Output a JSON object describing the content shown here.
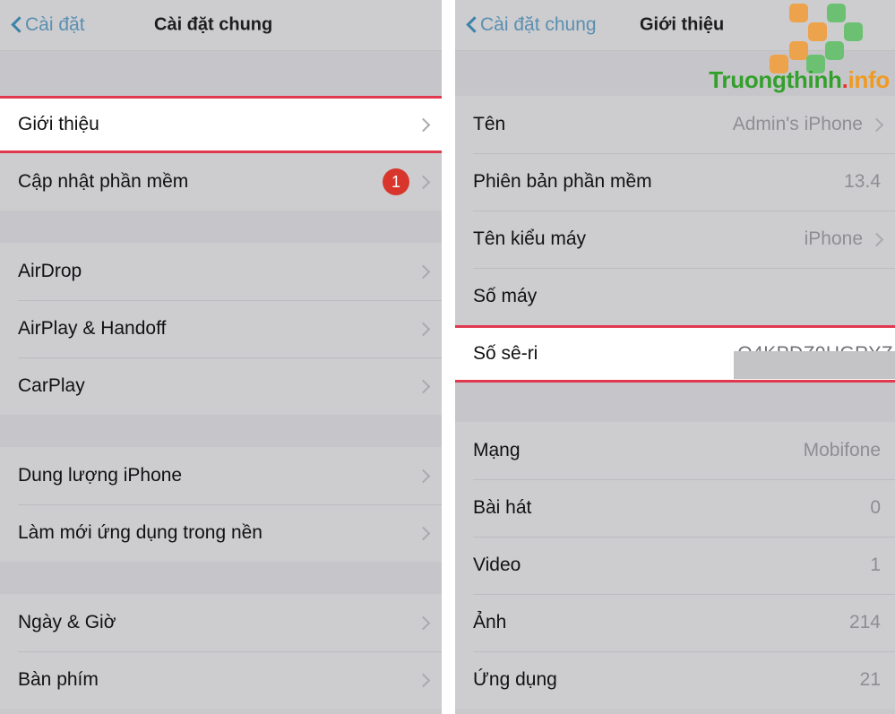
{
  "left_panel": {
    "nav": {
      "back_label": "Cài đặt",
      "back_icon": "chevron-left-icon",
      "title": "Cài đặt chung"
    },
    "groups": [
      {
        "rows": [
          {
            "label": "Giới thiệu",
            "value": "",
            "chevron": true,
            "badge": null,
            "highlighted": true
          },
          {
            "label": "Cập nhật phần mềm",
            "value": "",
            "chevron": true,
            "badge": "1",
            "highlighted": false
          }
        ]
      },
      {
        "rows": [
          {
            "label": "AirDrop",
            "value": "",
            "chevron": true,
            "badge": null,
            "highlighted": false
          },
          {
            "label": "AirPlay & Handoff",
            "value": "",
            "chevron": true,
            "badge": null,
            "highlighted": false
          },
          {
            "label": "CarPlay",
            "value": "",
            "chevron": true,
            "badge": null,
            "highlighted": false
          }
        ]
      },
      {
        "rows": [
          {
            "label": "Dung lượng iPhone",
            "value": "",
            "chevron": true,
            "badge": null,
            "highlighted": false
          },
          {
            "label": "Làm mới ứng dụng trong nền",
            "value": "",
            "chevron": true,
            "badge": null,
            "highlighted": false
          }
        ]
      },
      {
        "rows": [
          {
            "label": "Ngày & Giờ",
            "value": "",
            "chevron": true,
            "badge": null,
            "highlighted": false
          },
          {
            "label": "Bàn phím",
            "value": "",
            "chevron": true,
            "badge": null,
            "highlighted": false
          }
        ]
      }
    ]
  },
  "right_panel": {
    "nav": {
      "back_label": "Cài đặt chung",
      "back_icon": "chevron-left-icon",
      "title": "Giới thiệu"
    },
    "groups": [
      {
        "rows": [
          {
            "label": "Tên",
            "value": "Admin's iPhone",
            "chevron": true,
            "badge": null,
            "highlighted": false
          },
          {
            "label": "Phiên bản phần mềm",
            "value": "13.4",
            "chevron": false,
            "badge": null,
            "highlighted": false
          },
          {
            "label": "Tên kiểu máy",
            "value": "iPhone",
            "chevron": true,
            "badge": null,
            "highlighted": false
          },
          {
            "label": "Số máy",
            "value": "",
            "chevron": false,
            "badge": null,
            "highlighted": false
          },
          {
            "label": "Số sê-ri",
            "value": "Q4KPDZ0HGRYZ",
            "chevron": false,
            "badge": null,
            "highlighted": true,
            "censored": true
          }
        ]
      },
      {
        "rows": [
          {
            "label": "Mạng",
            "value": "Mobifone",
            "chevron": false,
            "badge": null,
            "highlighted": false
          },
          {
            "label": "Bài hát",
            "value": "0",
            "chevron": false,
            "badge": null,
            "highlighted": false
          },
          {
            "label": "Video",
            "value": "1",
            "chevron": false,
            "badge": null,
            "highlighted": false
          },
          {
            "label": "Ảnh",
            "value": "214",
            "chevron": false,
            "badge": null,
            "highlighted": false
          },
          {
            "label": "Ứng dụng",
            "value": "21",
            "chevron": false,
            "badge": null,
            "highlighted": false
          }
        ]
      }
    ]
  },
  "watermark": {
    "brand_part1": "Truongthinh",
    "brand_dot": ".",
    "brand_part2": "info",
    "logo_icon": "pixel-blocks-logo",
    "colors": {
      "green": "#33a02c",
      "red": "#e8352a",
      "orange": "#f09a22",
      "block_orange": "#eda24c",
      "block_green": "#6cc072"
    }
  },
  "theme": {
    "highlight_border": "#e0394f",
    "badge_bg": "#d8362c",
    "link_blue": "#5a8fb0",
    "row_bg": "#cdcdd0",
    "gap_bg": "#c6c6ca",
    "value_gray": "#8e8e93"
  }
}
